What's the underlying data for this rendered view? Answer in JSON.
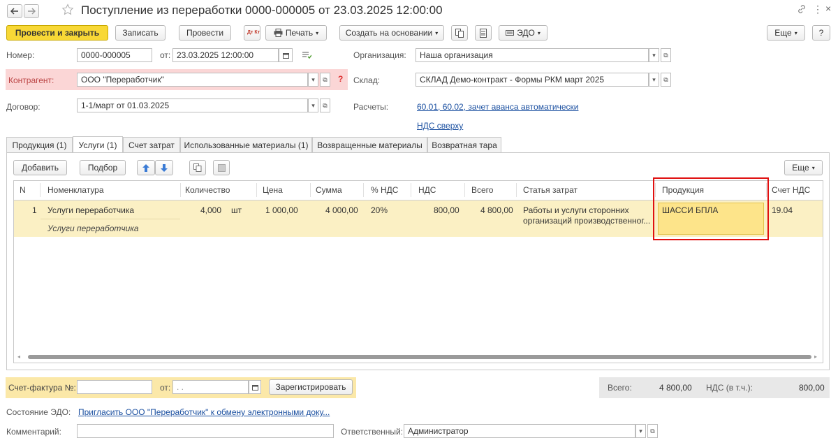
{
  "window": {
    "title": "Поступление из переработки 0000-000005 от 23.03.2025 12:00:00",
    "more_menu": "⋮",
    "close": "×"
  },
  "toolbar": {
    "post_close": "Провести и закрыть",
    "save": "Записать",
    "post": "Провести",
    "dtkt": "Дт Кт",
    "print": "Печать",
    "create_based": "Создать на основании",
    "edo": "ЭДО",
    "more": "Еще",
    "help": "?"
  },
  "form": {
    "number_label": "Номер:",
    "number": "0000-000005",
    "from_label": "от:",
    "date": "23.03.2025 12:00:00",
    "org_label": "Организация:",
    "org": "Наша организация",
    "contractor_label": "Контрагент:",
    "contractor": "ООО \"Переработчик\"",
    "question": "?",
    "warehouse_label": "Склад:",
    "warehouse": "СКЛАД Демо-контракт - Формы РКМ март 2025",
    "contract_label": "Договор:",
    "contract": "1-1/март от 01.03.2025",
    "settlements_label": "Расчеты:",
    "settlements_link": "60.01, 60.02, зачет аванса автоматически",
    "vat_link": "НДС сверху"
  },
  "tabs": [
    {
      "label": "Продукция (1)"
    },
    {
      "label": "Услуги (1)"
    },
    {
      "label": "Счет затрат"
    },
    {
      "label": "Использованные материалы (1)"
    },
    {
      "label": "Возвращенные материалы"
    },
    {
      "label": "Возвратная тара"
    }
  ],
  "table_toolbar": {
    "add": "Добавить",
    "pick": "Подбор",
    "more": "Еще"
  },
  "table": {
    "columns": [
      "N",
      "Номенклатура",
      "Количество",
      "Цена",
      "Сумма",
      "% НДС",
      "НДС",
      "Всего",
      "Статья затрат",
      "Продукция",
      "Счет НДС"
    ],
    "rows": [
      {
        "n": "1",
        "item": "Услуги переработчика",
        "item_sub": "Услуги переработчика",
        "qty": "4,000",
        "unit": "шт",
        "price": "1 000,00",
        "sum": "4 000,00",
        "vat_rate": "20%",
        "vat": "800,00",
        "total": "4 800,00",
        "cost_item_1": "Работы и услуги сторонних",
        "cost_item_2": "организаций производственног...",
        "product": "ШАССИ БПЛА",
        "vat_account": "19.04"
      }
    ]
  },
  "footer": {
    "invoice_label": "Счет-фактура №:",
    "invoice_no": "",
    "from_label": "от:",
    "invoice_date": " .  .",
    "register": "Зарегистрировать",
    "total_label": "Всего:",
    "total": "4 800,00",
    "vat_incl_label": "НДС (в т.ч.):",
    "vat_total": "800,00",
    "edo_state_label": "Состояние ЭДО:",
    "edo_link": "Пригласить ООО \"Переработчик\" к обмену электронными доку...",
    "comment_label": "Комментарий:",
    "comment": "",
    "responsible_label": "Ответственный:",
    "responsible": "Администратор"
  },
  "colors": {
    "accent_yellow": "#f8d836",
    "row_highlight": "#fbf0c4",
    "selected_cell": "#fde48a",
    "contractor_bg": "#fbd6d6",
    "link": "#1a4fa0",
    "annotation_red": "#e01010"
  }
}
